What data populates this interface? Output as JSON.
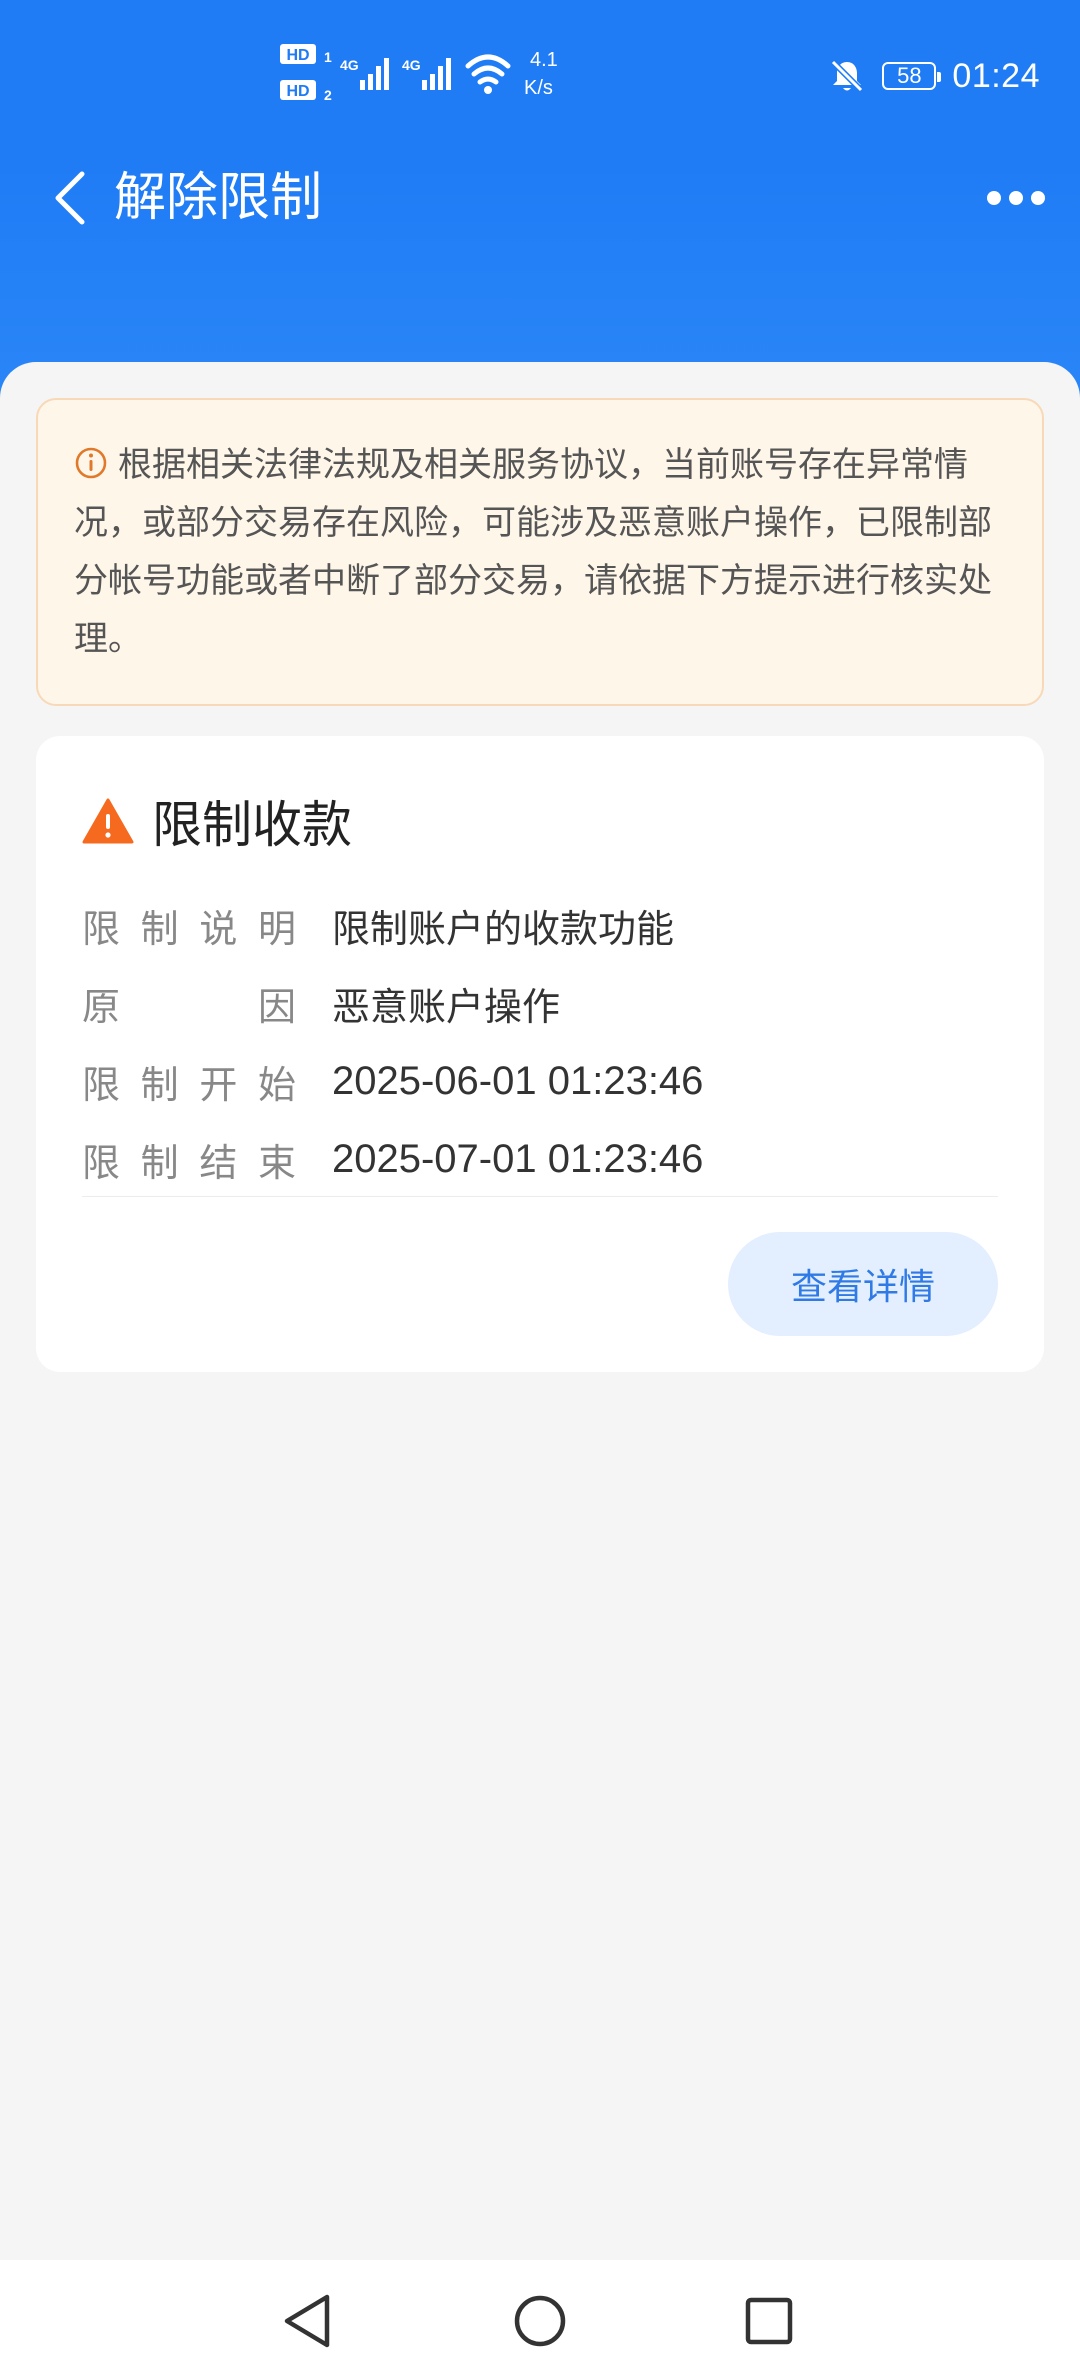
{
  "status_bar": {
    "sim1": "HD",
    "sim1_index": "1",
    "sim2": "HD",
    "sim2_index": "2",
    "net1": "4G",
    "net2": "4G",
    "speed_value": "4.1",
    "speed_unit": "K/s",
    "battery": "58",
    "time": "01:24",
    "icons": [
      "signal-icon",
      "wifi-icon",
      "mute-bell-icon",
      "battery-icon"
    ]
  },
  "nav": {
    "title": "解除限制",
    "back_icon": "chevron-left-icon",
    "more_icon": "more-dots-icon"
  },
  "notice": {
    "icon": "info-circle-icon",
    "text": "根据相关法律法规及相关服务协议，当前账号存在异常情况，或部分交易存在风险，可能涉及恶意账户操作，已限制部分帐号功能或者中断了部分交易，请依据下方提示进行核实处理。"
  },
  "restriction": {
    "icon": "warning-triangle-icon",
    "title": "限制收款",
    "rows": [
      {
        "label": [
          "限",
          "制",
          "说",
          "明"
        ],
        "value": "限制账户的收款功能"
      },
      {
        "label": [
          "原",
          "因"
        ],
        "value": "恶意账户操作"
      },
      {
        "label": [
          "限",
          "制",
          "开",
          "始"
        ],
        "value": "2025-06-01 01:23:46"
      },
      {
        "label": [
          "限",
          "制",
          "结",
          "束"
        ],
        "value": "2025-07-01 01:23:46"
      }
    ],
    "detail_button": "查看详情"
  },
  "system_nav": {
    "icons": [
      "back-triangle-icon",
      "home-circle-icon",
      "recents-square-icon"
    ]
  },
  "colors": {
    "primary": "#1f7cf5",
    "notice_bg": "#fff6ea",
    "notice_border": "#f7d9b8",
    "warning": "#f56a1e",
    "button_bg": "#e3efff",
    "button_text": "#2f7ae5"
  }
}
